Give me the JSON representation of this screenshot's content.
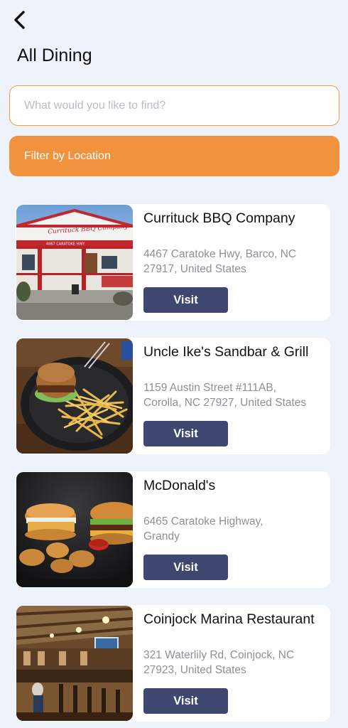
{
  "header": {
    "back_icon": "chevron-left-icon",
    "title": "All Dining"
  },
  "search": {
    "placeholder": "What would you like to find?",
    "value": ""
  },
  "filter": {
    "label": "Filter by Location"
  },
  "colors": {
    "accent": "#f0923e",
    "search_border": "#ef9a4e",
    "button": "#3f4670",
    "background": "#eef2fa"
  },
  "restaurants": [
    {
      "name": "Currituck BBQ Company",
      "address_line1": "4467 Caratoke Hwy, Barco, NC",
      "address_line2": "27917, United States",
      "visit_label": "Visit",
      "sign_text": "Currituck BBQ Company",
      "sign_address": "4467 CARATOKE HWY"
    },
    {
      "name": "Uncle Ike's Sandbar & Grill",
      "address_line1": "1159 Austin Street #111AB,",
      "address_line2": "Corolla, NC 27927, United States",
      "visit_label": "Visit"
    },
    {
      "name": "McDonald's",
      "address_line1": "6465 Caratoke Highway,",
      "address_line2": "Grandy",
      "visit_label": "Visit"
    },
    {
      "name": "Coinjock Marina Restaurant",
      "address_line1": "321 Waterlily Rd, Coinjock, NC",
      "address_line2": "27923, United States",
      "visit_label": "Visit"
    }
  ]
}
